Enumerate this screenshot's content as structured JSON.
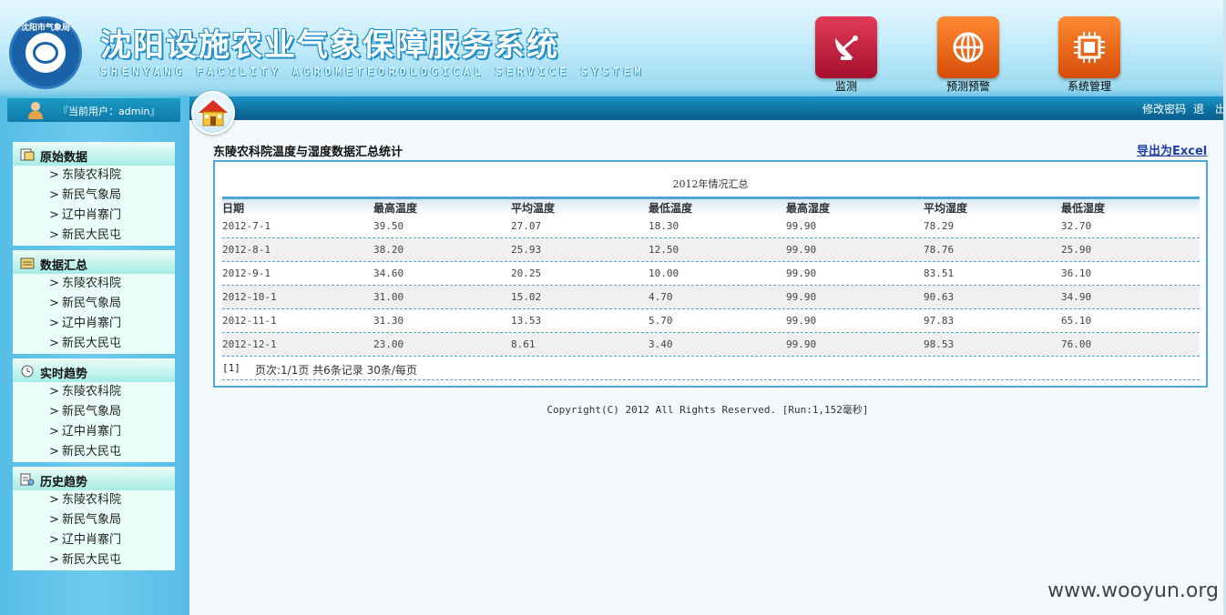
{
  "header": {
    "title_cn": "沈阳设施农业气象保障服务系统",
    "title_en": "SHENYANG FACILITY AGROMETEOROLOGICAL SERVICE SYSTEM",
    "logo_text": "沈阳市气象局",
    "nav": [
      {
        "label": "监测",
        "icon": "satellite-dish-icon",
        "color": "#c0192f"
      },
      {
        "label": "预测预警",
        "icon": "globe-icon",
        "color": "#f2701a"
      },
      {
        "label": "系统管理",
        "icon": "chip-icon",
        "color": "#f2701a"
      }
    ]
  },
  "user": {
    "label": "『当前用户：admin』"
  },
  "sidebar": {
    "groups": [
      {
        "title": "原始数据",
        "icon": "database-icon",
        "items": [
          "东陵农科院",
          "新民气象局",
          "辽中肖寨门",
          "新民大民屯"
        ]
      },
      {
        "title": "数据汇总",
        "icon": "summary-icon",
        "items": [
          "东陵农科院",
          "新民气象局",
          "辽中肖寨门",
          "新民大民屯"
        ]
      },
      {
        "title": "实时趋势",
        "icon": "realtime-icon",
        "items": [
          "东陵农科院",
          "新民气象局",
          "辽中肖寨门",
          "新民大民屯"
        ]
      },
      {
        "title": "历史趋势",
        "icon": "history-icon",
        "items": [
          "东陵农科院",
          "新民气象局",
          "辽中肖寨门",
          "新民大民屯"
        ]
      }
    ],
    "arrow": ">"
  },
  "ribbon": {
    "links": [
      "修改密码",
      "退　出"
    ]
  },
  "page": {
    "heading": "东陵农科院温度与湿度数据汇总统计",
    "export_label": "导出为Excel",
    "caption": "2012年情况汇总"
  },
  "table": {
    "columns": [
      "日期",
      "最高温度",
      "平均温度",
      "最低温度",
      "最高湿度",
      "平均湿度",
      "最低湿度"
    ],
    "rows": [
      [
        "2012-7-1",
        "39.50",
        "27.07",
        "18.30",
        "99.90",
        "78.29",
        "32.70"
      ],
      [
        "2012-8-1",
        "38.20",
        "25.93",
        "12.50",
        "99.90",
        "78.76",
        "25.90"
      ],
      [
        "2012-9-1",
        "34.60",
        "20.25",
        "10.00",
        "99.90",
        "83.51",
        "36.10"
      ],
      [
        "2012-10-1",
        "31.00",
        "15.02",
        "4.70",
        "99.90",
        "90.63",
        "34.90"
      ],
      [
        "2012-11-1",
        "31.30",
        "13.53",
        "5.70",
        "99.90",
        "97.83",
        "65.10"
      ],
      [
        "2012-12-1",
        "23.00",
        "8.61",
        "3.40",
        "99.90",
        "98.53",
        "76.00"
      ]
    ]
  },
  "pager": {
    "current": "[1]",
    "info": "页次:1/1页 共6条记录 30条/每页"
  },
  "footer": {
    "copyright": "Copyright(C) 2012 All Rights Reserved. [Run:1,152毫秒]"
  },
  "watermark": "www.wooyun.org",
  "colors": {
    "accent": "#4fa6d1",
    "ribbon": "#0c6fa0",
    "link": "#1e3fa8"
  }
}
